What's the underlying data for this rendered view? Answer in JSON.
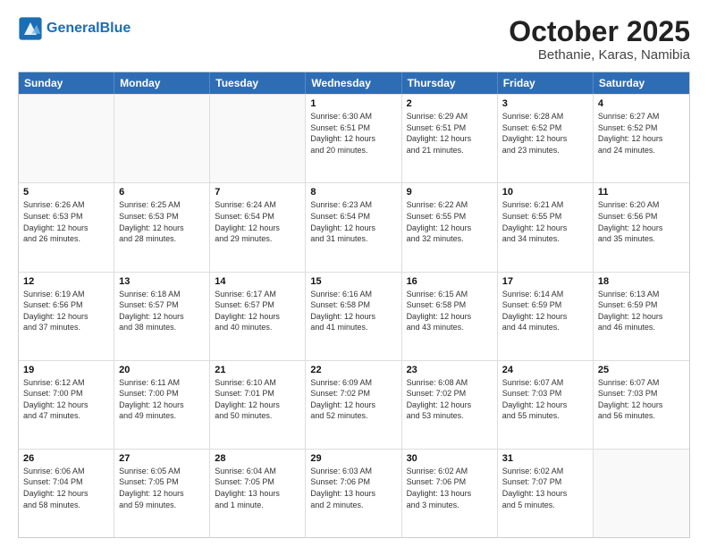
{
  "header": {
    "logo_general": "General",
    "logo_blue": "Blue",
    "title": "October 2025",
    "subtitle": "Bethanie, Karas, Namibia"
  },
  "days_of_week": [
    "Sunday",
    "Monday",
    "Tuesday",
    "Wednesday",
    "Thursday",
    "Friday",
    "Saturday"
  ],
  "rows": [
    [
      {
        "num": "",
        "lines": [],
        "empty": true
      },
      {
        "num": "",
        "lines": [],
        "empty": true
      },
      {
        "num": "",
        "lines": [],
        "empty": true
      },
      {
        "num": "1",
        "lines": [
          "Sunrise: 6:30 AM",
          "Sunset: 6:51 PM",
          "Daylight: 12 hours",
          "and 20 minutes."
        ]
      },
      {
        "num": "2",
        "lines": [
          "Sunrise: 6:29 AM",
          "Sunset: 6:51 PM",
          "Daylight: 12 hours",
          "and 21 minutes."
        ]
      },
      {
        "num": "3",
        "lines": [
          "Sunrise: 6:28 AM",
          "Sunset: 6:52 PM",
          "Daylight: 12 hours",
          "and 23 minutes."
        ]
      },
      {
        "num": "4",
        "lines": [
          "Sunrise: 6:27 AM",
          "Sunset: 6:52 PM",
          "Daylight: 12 hours",
          "and 24 minutes."
        ]
      }
    ],
    [
      {
        "num": "5",
        "lines": [
          "Sunrise: 6:26 AM",
          "Sunset: 6:53 PM",
          "Daylight: 12 hours",
          "and 26 minutes."
        ]
      },
      {
        "num": "6",
        "lines": [
          "Sunrise: 6:25 AM",
          "Sunset: 6:53 PM",
          "Daylight: 12 hours",
          "and 28 minutes."
        ]
      },
      {
        "num": "7",
        "lines": [
          "Sunrise: 6:24 AM",
          "Sunset: 6:54 PM",
          "Daylight: 12 hours",
          "and 29 minutes."
        ]
      },
      {
        "num": "8",
        "lines": [
          "Sunrise: 6:23 AM",
          "Sunset: 6:54 PM",
          "Daylight: 12 hours",
          "and 31 minutes."
        ]
      },
      {
        "num": "9",
        "lines": [
          "Sunrise: 6:22 AM",
          "Sunset: 6:55 PM",
          "Daylight: 12 hours",
          "and 32 minutes."
        ]
      },
      {
        "num": "10",
        "lines": [
          "Sunrise: 6:21 AM",
          "Sunset: 6:55 PM",
          "Daylight: 12 hours",
          "and 34 minutes."
        ]
      },
      {
        "num": "11",
        "lines": [
          "Sunrise: 6:20 AM",
          "Sunset: 6:56 PM",
          "Daylight: 12 hours",
          "and 35 minutes."
        ]
      }
    ],
    [
      {
        "num": "12",
        "lines": [
          "Sunrise: 6:19 AM",
          "Sunset: 6:56 PM",
          "Daylight: 12 hours",
          "and 37 minutes."
        ]
      },
      {
        "num": "13",
        "lines": [
          "Sunrise: 6:18 AM",
          "Sunset: 6:57 PM",
          "Daylight: 12 hours",
          "and 38 minutes."
        ]
      },
      {
        "num": "14",
        "lines": [
          "Sunrise: 6:17 AM",
          "Sunset: 6:57 PM",
          "Daylight: 12 hours",
          "and 40 minutes."
        ]
      },
      {
        "num": "15",
        "lines": [
          "Sunrise: 6:16 AM",
          "Sunset: 6:58 PM",
          "Daylight: 12 hours",
          "and 41 minutes."
        ]
      },
      {
        "num": "16",
        "lines": [
          "Sunrise: 6:15 AM",
          "Sunset: 6:58 PM",
          "Daylight: 12 hours",
          "and 43 minutes."
        ]
      },
      {
        "num": "17",
        "lines": [
          "Sunrise: 6:14 AM",
          "Sunset: 6:59 PM",
          "Daylight: 12 hours",
          "and 44 minutes."
        ]
      },
      {
        "num": "18",
        "lines": [
          "Sunrise: 6:13 AM",
          "Sunset: 6:59 PM",
          "Daylight: 12 hours",
          "and 46 minutes."
        ]
      }
    ],
    [
      {
        "num": "19",
        "lines": [
          "Sunrise: 6:12 AM",
          "Sunset: 7:00 PM",
          "Daylight: 12 hours",
          "and 47 minutes."
        ]
      },
      {
        "num": "20",
        "lines": [
          "Sunrise: 6:11 AM",
          "Sunset: 7:00 PM",
          "Daylight: 12 hours",
          "and 49 minutes."
        ]
      },
      {
        "num": "21",
        "lines": [
          "Sunrise: 6:10 AM",
          "Sunset: 7:01 PM",
          "Daylight: 12 hours",
          "and 50 minutes."
        ]
      },
      {
        "num": "22",
        "lines": [
          "Sunrise: 6:09 AM",
          "Sunset: 7:02 PM",
          "Daylight: 12 hours",
          "and 52 minutes."
        ]
      },
      {
        "num": "23",
        "lines": [
          "Sunrise: 6:08 AM",
          "Sunset: 7:02 PM",
          "Daylight: 12 hours",
          "and 53 minutes."
        ]
      },
      {
        "num": "24",
        "lines": [
          "Sunrise: 6:07 AM",
          "Sunset: 7:03 PM",
          "Daylight: 12 hours",
          "and 55 minutes."
        ]
      },
      {
        "num": "25",
        "lines": [
          "Sunrise: 6:07 AM",
          "Sunset: 7:03 PM",
          "Daylight: 12 hours",
          "and 56 minutes."
        ]
      }
    ],
    [
      {
        "num": "26",
        "lines": [
          "Sunrise: 6:06 AM",
          "Sunset: 7:04 PM",
          "Daylight: 12 hours",
          "and 58 minutes."
        ]
      },
      {
        "num": "27",
        "lines": [
          "Sunrise: 6:05 AM",
          "Sunset: 7:05 PM",
          "Daylight: 12 hours",
          "and 59 minutes."
        ]
      },
      {
        "num": "28",
        "lines": [
          "Sunrise: 6:04 AM",
          "Sunset: 7:05 PM",
          "Daylight: 13 hours",
          "and 1 minute."
        ]
      },
      {
        "num": "29",
        "lines": [
          "Sunrise: 6:03 AM",
          "Sunset: 7:06 PM",
          "Daylight: 13 hours",
          "and 2 minutes."
        ]
      },
      {
        "num": "30",
        "lines": [
          "Sunrise: 6:02 AM",
          "Sunset: 7:06 PM",
          "Daylight: 13 hours",
          "and 3 minutes."
        ]
      },
      {
        "num": "31",
        "lines": [
          "Sunrise: 6:02 AM",
          "Sunset: 7:07 PM",
          "Daylight: 13 hours",
          "and 5 minutes."
        ]
      },
      {
        "num": "",
        "lines": [],
        "empty": true
      }
    ]
  ]
}
